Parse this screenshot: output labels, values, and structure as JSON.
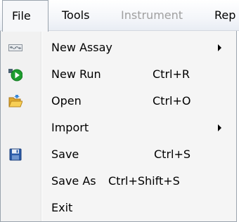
{
  "menubar": {
    "items": [
      {
        "label": "File"
      },
      {
        "label": "Tools"
      },
      {
        "label": "Instrument"
      },
      {
        "label": "Rep"
      }
    ]
  },
  "file_menu": {
    "items": [
      {
        "label": "New Assay",
        "shortcut": "",
        "icon": "assay-icon",
        "submenu": true
      },
      {
        "label": "New Run",
        "shortcut": "Ctrl+R",
        "icon": "run-icon"
      },
      {
        "label": "Open",
        "shortcut": "Ctrl+O",
        "icon": "open-folder-icon"
      },
      {
        "label": "Import",
        "shortcut": "",
        "submenu": true
      },
      {
        "label": "Save",
        "shortcut": "Ctrl+S",
        "icon": "save-disk-icon"
      },
      {
        "label": "Save As",
        "shortcut": "Ctrl+Shift+S"
      },
      {
        "label": "Exit",
        "shortcut": ""
      }
    ]
  }
}
